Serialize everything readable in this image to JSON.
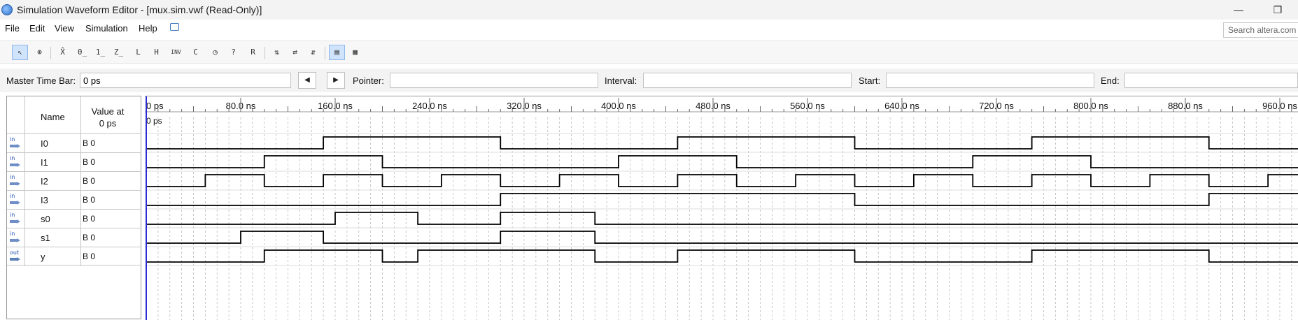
{
  "window": {
    "title": "Simulation Waveform Editor - [mux.sim.vwf (Read-Only)]",
    "minimize": "—",
    "maximize": "❐"
  },
  "menu": {
    "items": [
      "File",
      "Edit",
      "View",
      "Simulation",
      "Help"
    ],
    "search_placeholder": "Search altera.com"
  },
  "toolbar": {
    "tools": [
      {
        "name": "selection-tool-icon",
        "glyph": "↖",
        "active": true
      },
      {
        "name": "zoom-tool-icon",
        "glyph": "⊕",
        "active": false
      },
      {
        "name": "unknown-value-icon",
        "glyph": "X̂",
        "active": false
      },
      {
        "name": "force-low-icon",
        "glyph": "0̲",
        "active": false
      },
      {
        "name": "force-high-icon",
        "glyph": "1̲",
        "active": false
      },
      {
        "name": "high-impedance-icon",
        "glyph": "Z̲",
        "active": false
      },
      {
        "name": "weak-low-icon",
        "glyph": "L",
        "active": false
      },
      {
        "name": "weak-high-icon",
        "glyph": "H",
        "active": false
      },
      {
        "name": "invert-icon",
        "glyph": "INV",
        "active": false
      },
      {
        "name": "count-value-icon",
        "glyph": "C",
        "active": false
      },
      {
        "name": "overwrite-clock-icon",
        "glyph": "◷",
        "active": false
      },
      {
        "name": "arbitrary-value-icon",
        "glyph": "?",
        "active": false
      },
      {
        "name": "random-value-icon",
        "glyph": "R",
        "active": false
      },
      {
        "name": "snap-to-grid-icon",
        "glyph": "⇅",
        "active": false
      },
      {
        "name": "grid-settings-icon",
        "glyph": "⇄",
        "active": false
      },
      {
        "name": "sort-icon",
        "glyph": "⇵",
        "active": false
      },
      {
        "name": "waveform-view-icon",
        "glyph": "▤",
        "active": true
      },
      {
        "name": "hierarchy-view-icon",
        "glyph": "▦",
        "active": false
      }
    ]
  },
  "timebar": {
    "master_label": "Master Time Bar:",
    "master_value": "0 ps",
    "pointer_label": "Pointer:",
    "pointer_value": "",
    "interval_label": "Interval:",
    "interval_value": "",
    "start_label": "Start:",
    "start_value": "",
    "end_label": "End:",
    "end_value": "",
    "prev_glyph": "◀",
    "next_glyph": "▶"
  },
  "signals": {
    "header_name": "Name",
    "header_value": "Value at\n0 ps",
    "header_value_line1": "Value at",
    "header_value_line2": "0 ps",
    "rows": [
      {
        "io": "in",
        "name": "I0",
        "value": "B 0"
      },
      {
        "io": "in",
        "name": "I1",
        "value": "B 0"
      },
      {
        "io": "in",
        "name": "I2",
        "value": "B 0"
      },
      {
        "io": "in",
        "name": "I3",
        "value": "B 0"
      },
      {
        "io": "in",
        "name": "s0",
        "value": "B 0"
      },
      {
        "io": "in",
        "name": "s1",
        "value": "B 0"
      },
      {
        "io": "out",
        "name": "y",
        "value": "B 0"
      }
    ]
  },
  "ruler": {
    "time_unit": "ns",
    "cursor_label": "0 ps",
    "ticks": [
      {
        "t": 0,
        "label": "0 ps"
      },
      {
        "t": 80,
        "label": "80.0 ns"
      },
      {
        "t": 160,
        "label": "160.0 ns"
      },
      {
        "t": 240,
        "label": "240.0 ns"
      },
      {
        "t": 320,
        "label": "320.0 ns"
      },
      {
        "t": 400,
        "label": "400.0 ns"
      },
      {
        "t": 480,
        "label": "480.0 ns"
      },
      {
        "t": 560,
        "label": "560.0 ns"
      },
      {
        "t": 640,
        "label": "640.0 ns"
      },
      {
        "t": 720,
        "label": "720.0 ns"
      },
      {
        "t": 800,
        "label": "800.0 ns"
      },
      {
        "t": 880,
        "label": "880.0 ns"
      },
      {
        "t": 960,
        "label": "960.0 ns"
      }
    ]
  },
  "waveforms": [
    {
      "signal": "I0",
      "initial": 0,
      "transitions": [
        150,
        300,
        450,
        600,
        750,
        900
      ]
    },
    {
      "signal": "I1",
      "initial": 0,
      "transitions": [
        100,
        200,
        400,
        500,
        700,
        800
      ]
    },
    {
      "signal": "I2",
      "initial": 0,
      "transitions": [
        50,
        100,
        150,
        200,
        250,
        300,
        350,
        400,
        450,
        500,
        550,
        600,
        650,
        700,
        750,
        800,
        850,
        900,
        950
      ]
    },
    {
      "signal": "I3",
      "initial": 0,
      "transitions": [
        300,
        600,
        900
      ]
    },
    {
      "signal": "s0",
      "initial": 0,
      "transitions": [
        160,
        230,
        300,
        380
      ]
    },
    {
      "signal": "s1",
      "initial": 0,
      "transitions": [
        80,
        150,
        300,
        380
      ]
    },
    {
      "signal": "y",
      "initial": 0,
      "transitions": [
        100,
        200,
        230,
        380,
        450,
        600,
        750,
        900
      ]
    }
  ],
  "colors": {
    "cursor": "#2b2bd6",
    "wave": "#000000",
    "grid": "#b9b9b9"
  }
}
